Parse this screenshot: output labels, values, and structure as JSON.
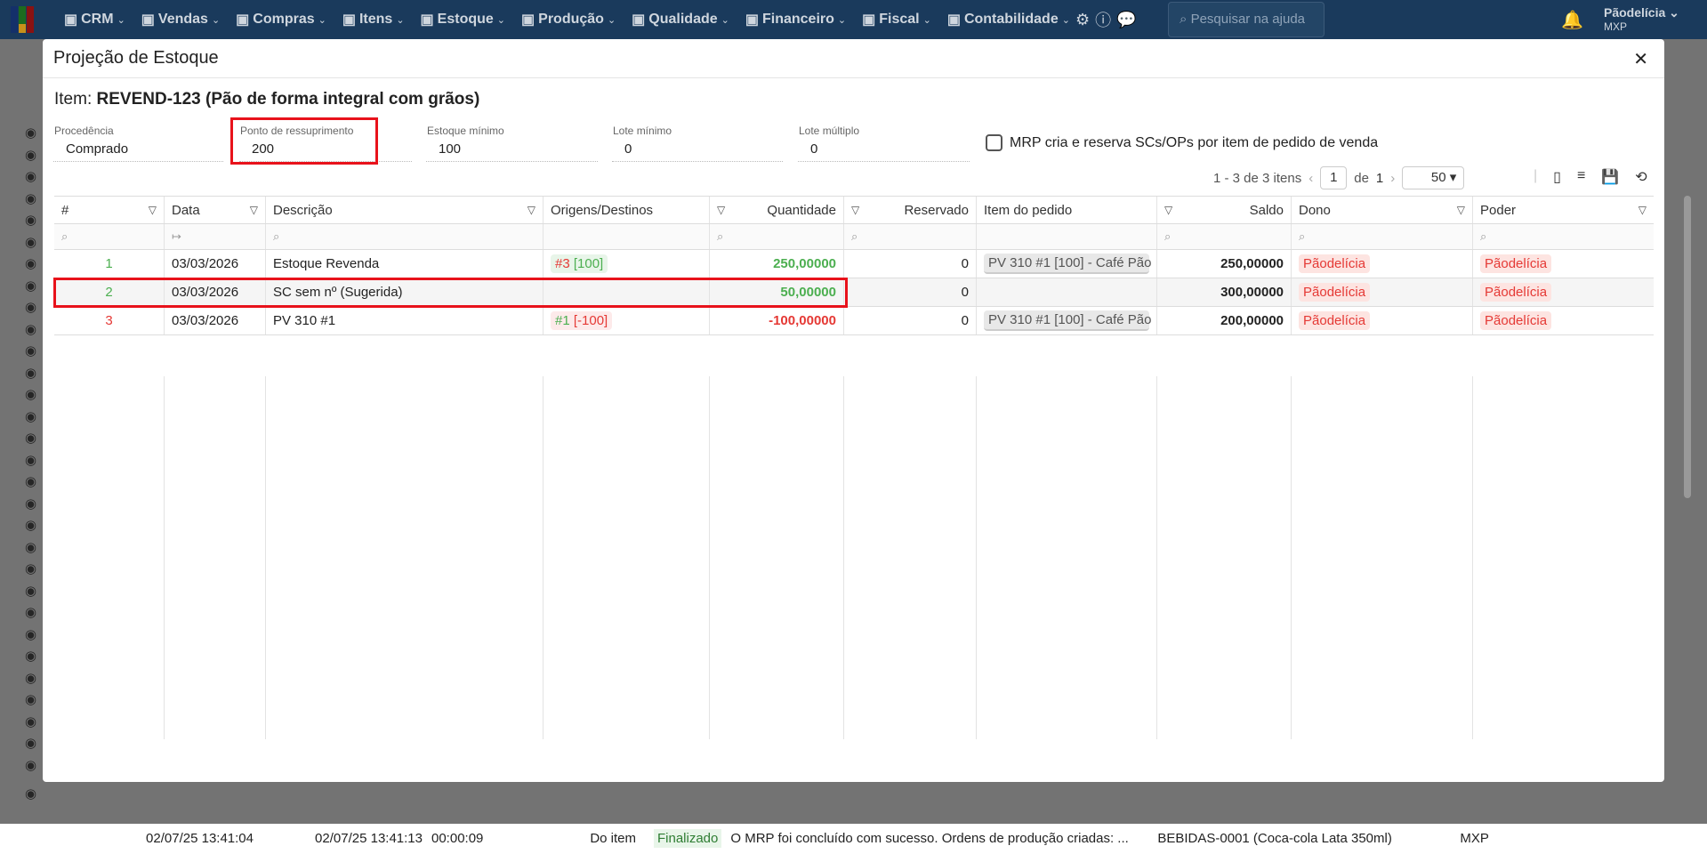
{
  "nav": {
    "items": [
      "CRM",
      "Vendas",
      "Compras",
      "Itens",
      "Estoque",
      "Produção",
      "Qualidade",
      "Financeiro",
      "Fiscal",
      "Contabilidade"
    ],
    "icons": [
      "crm-icon",
      "dollar-icon",
      "cart-icon",
      "items-icon",
      "stock-icon",
      "factory-icon",
      "quality-icon",
      "money-bag-icon",
      "fiscal-icon",
      "calculator-icon"
    ],
    "search_placeholder": "Pesquisar na ajuda",
    "user": "Pãodelícia",
    "company": "MXP"
  },
  "background": {
    "row": {
      "start": "02/07/25 13:41:04",
      "end": "02/07/25 13:41:13",
      "duration": "00:00:09",
      "type": "Do item",
      "status": "Finalizado",
      "message": "O MRP foi concluído com sucesso. Ordens de produção criadas: ...",
      "item": "BEBIDAS-0001 (Coca-cola Lata 350ml)",
      "company": "MXP"
    }
  },
  "modal": {
    "title": "Projeção de Estoque",
    "item_label": "Item:",
    "item_value": "REVEND-123 (Pão de forma integral com grãos)",
    "fields": [
      {
        "label": "Procedência",
        "value": "Comprado"
      },
      {
        "label": "Ponto de ressuprimento",
        "value": "200"
      },
      {
        "label": "Estoque mínimo",
        "value": "100"
      },
      {
        "label": "Lote mínimo",
        "value": "0"
      },
      {
        "label": "Lote múltiplo",
        "value": "0"
      }
    ],
    "checkbox_label": "MRP cria e reserva SCs/OPs por item de pedido de venda",
    "checkbox_checked": false,
    "pager": {
      "range": "1 - 3 de 3 itens",
      "page": "1",
      "of": "de",
      "total": "1",
      "page_size": "50"
    },
    "columns": [
      "#",
      "Data",
      "Descrição",
      "Origens/Destinos",
      "Quantidade",
      "Reservado",
      "Item do pedido",
      "Saldo",
      "Dono",
      "Poder"
    ],
    "rows": [
      {
        "n": "1",
        "date": "03/03/2026",
        "desc": "Estoque Revenda",
        "orig_a": "#3",
        "orig_b": "[100]",
        "qty": "250,00000",
        "res": "0",
        "order_item": "PV 310 #1 [100] - Café Pão",
        "saldo": "250,00000",
        "dono": "Pãodelícia",
        "poder": "Pãodelícia"
      },
      {
        "n": "2",
        "date": "03/03/2026",
        "desc": "SC sem nº (Sugerida)",
        "orig_a": "",
        "orig_b": "",
        "qty": "50,00000",
        "res": "0",
        "order_item": "",
        "saldo": "300,00000",
        "dono": "Pãodelícia",
        "poder": "Pãodelícia"
      },
      {
        "n": "3",
        "date": "03/03/2026",
        "desc": "PV 310 #1",
        "orig_a": "#1",
        "orig_b": "[-100]",
        "qty": "-100,00000",
        "res": "0",
        "order_item": "PV 310 #1 [100] - Café Pão",
        "saldo": "200,00000",
        "dono": "Pãodelícia",
        "poder": "Pãodelícia"
      }
    ]
  }
}
